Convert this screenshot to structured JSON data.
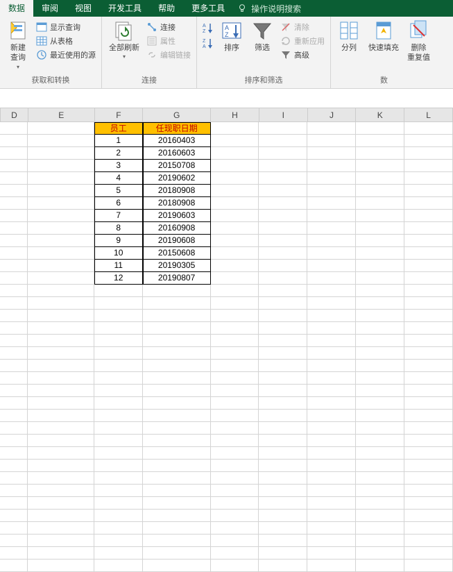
{
  "tabs": {
    "data": "数据",
    "review": "审阅",
    "view": "视图",
    "developer": "开发工具",
    "help": "帮助",
    "more": "更多工具",
    "tell_me": "操作说明搜索"
  },
  "ribbon": {
    "group1": {
      "new_query": "新建\n查询",
      "show_queries": "显示查询",
      "from_table": "从表格",
      "recent_sources": "最近使用的源",
      "label": "获取和转换"
    },
    "group2": {
      "refresh_all": "全部刷新",
      "connections": "连接",
      "properties": "属性",
      "edit_links": "编辑链接",
      "label": "连接"
    },
    "group3": {
      "sort": "排序",
      "filter": "筛选",
      "clear": "清除",
      "reapply": "重新应用",
      "advanced": "高级",
      "label": "排序和筛选"
    },
    "group4": {
      "text_to_cols": "分列",
      "flash_fill": "快速填充",
      "remove_dup": "删除\n重复值",
      "label": "数"
    }
  },
  "columns": [
    "D",
    "E",
    "F",
    "G",
    "H",
    "I",
    "J",
    "K",
    "L"
  ],
  "chart_data": {
    "type": "table",
    "headers": {
      "f": "员工",
      "g": "任现职日期"
    },
    "rows": [
      {
        "f": "1",
        "g": "20160403"
      },
      {
        "f": "2",
        "g": "20160603"
      },
      {
        "f": "3",
        "g": "20150708"
      },
      {
        "f": "4",
        "g": "20190602"
      },
      {
        "f": "5",
        "g": "20180908"
      },
      {
        "f": "6",
        "g": "20180908"
      },
      {
        "f": "7",
        "g": "20190603"
      },
      {
        "f": "8",
        "g": "20160908"
      },
      {
        "f": "9",
        "g": "20190608"
      },
      {
        "f": "10",
        "g": "20150608"
      },
      {
        "f": "11",
        "g": "20190305"
      },
      {
        "f": "12",
        "g": "20190807"
      }
    ]
  }
}
